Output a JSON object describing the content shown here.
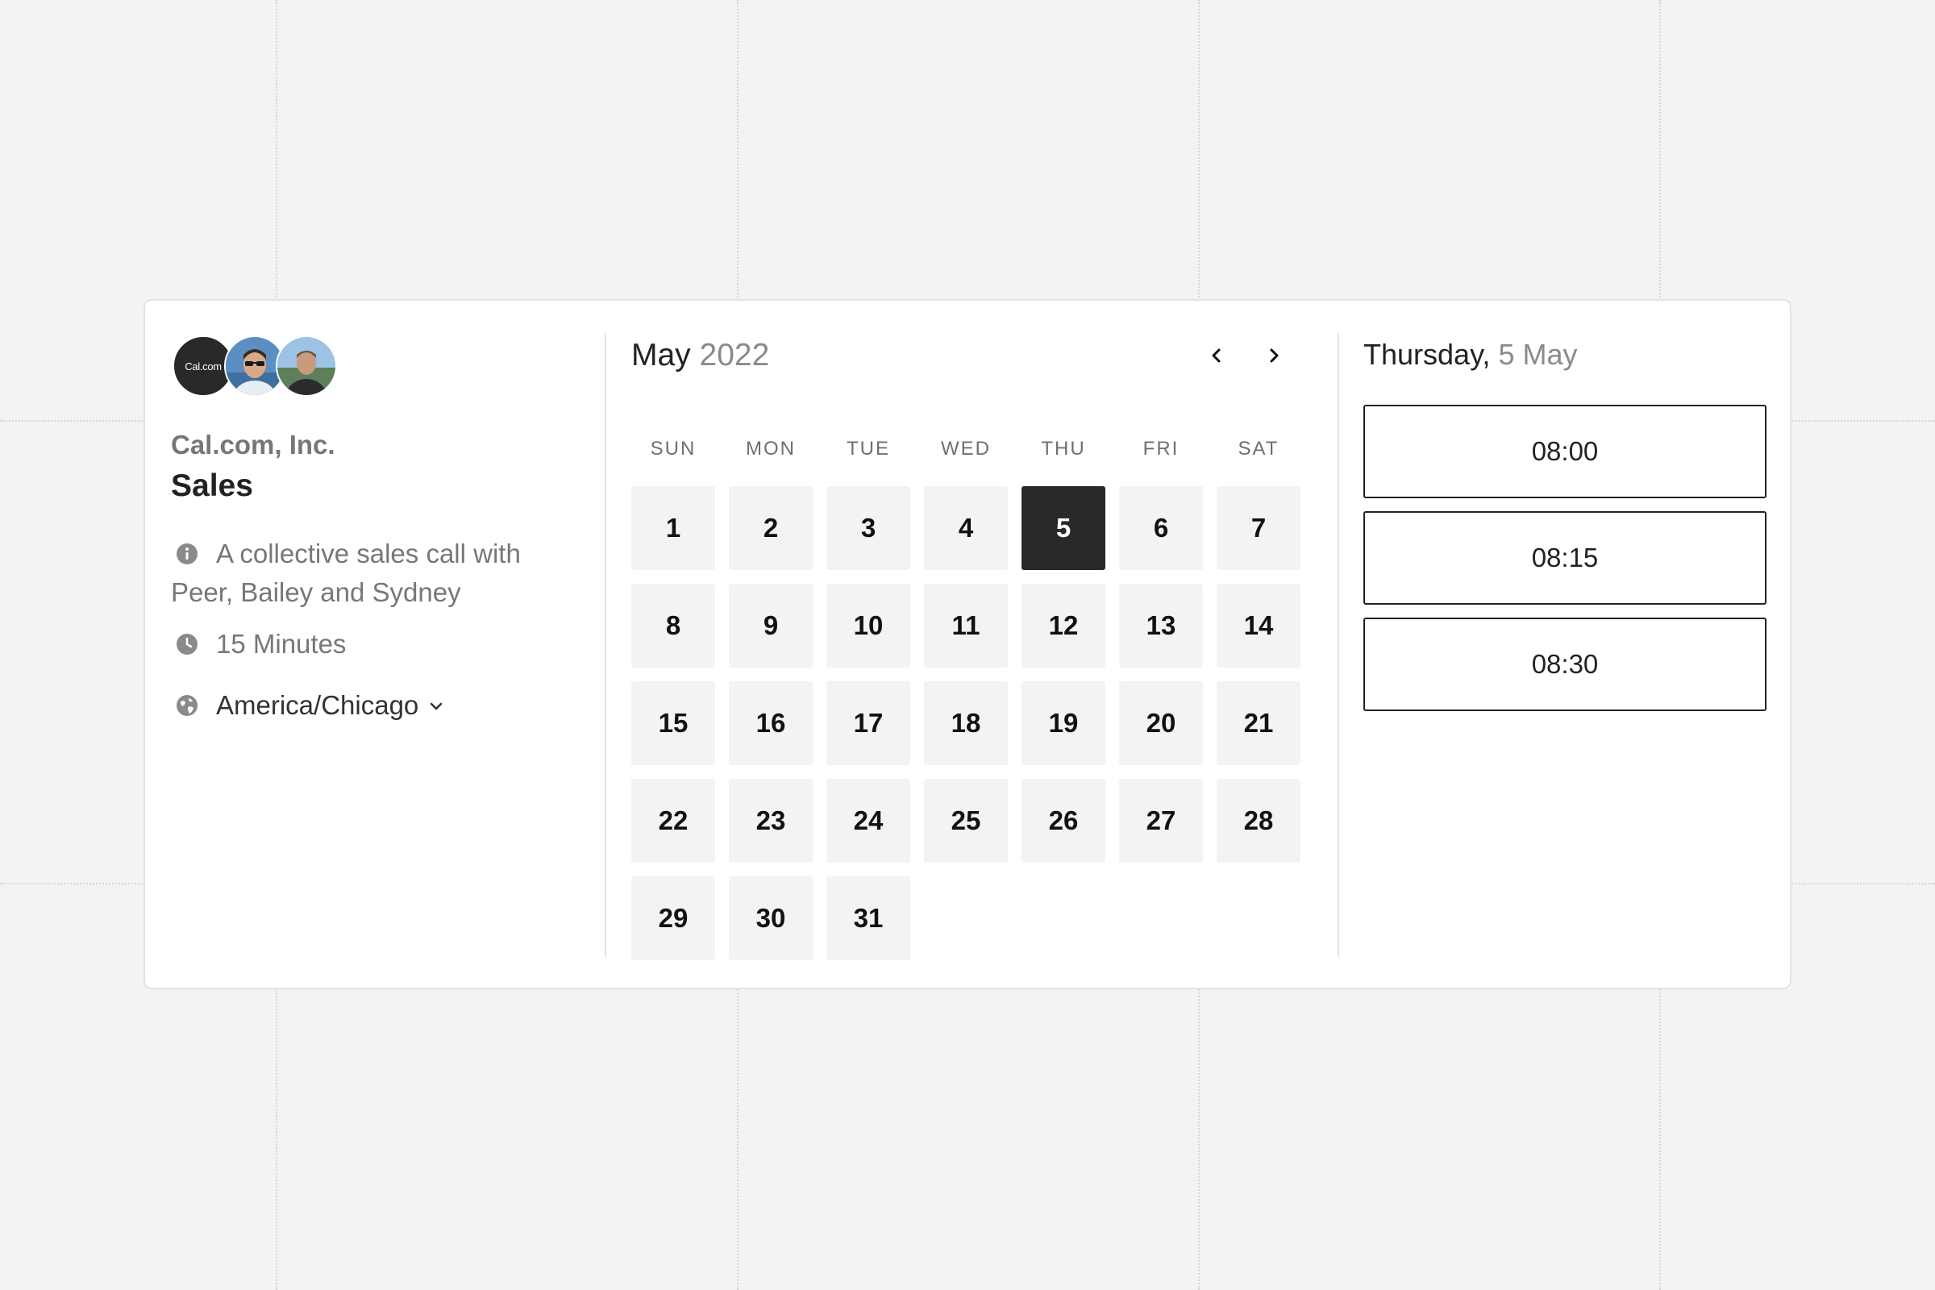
{
  "profile": {
    "logo_text": "Cal.com",
    "org_name": "Cal.com, Inc.",
    "event_title": "Sales",
    "description": "A collective sales call with Peer, Bailey and Sydney",
    "duration": "15 Minutes",
    "timezone": "America/Chicago"
  },
  "calendar": {
    "month": "May",
    "year": "2022",
    "weekdays": [
      "SUN",
      "MON",
      "TUE",
      "WED",
      "THU",
      "FRI",
      "SAT"
    ],
    "first_weekday_index": 0,
    "days_in_month": 31,
    "selected_day": "5"
  },
  "selection": {
    "weekday": "Thursday",
    "date": "5 May",
    "slots": [
      "08:00",
      "08:15",
      "08:30"
    ]
  },
  "colors": {
    "background": "#f3f3f3",
    "card": "#ffffff",
    "day_cell": "#f3f3f3",
    "selected_day": "#292929",
    "muted_text": "#777777"
  },
  "icons": {
    "description": "info-icon",
    "duration": "clock-icon",
    "timezone": "globe-icon",
    "timezone_dropdown": "chevron-down-icon",
    "prev_month": "chevron-left-icon",
    "next_month": "chevron-right-icon"
  }
}
